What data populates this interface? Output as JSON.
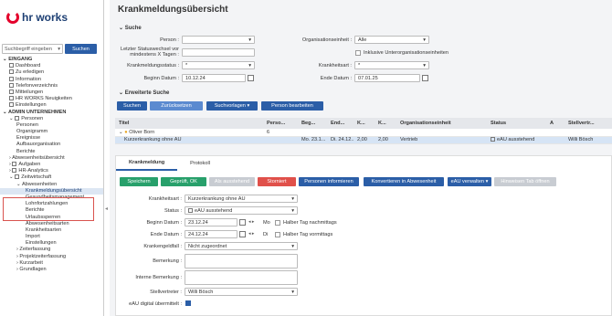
{
  "app": {
    "logo": "hr works"
  },
  "search": {
    "placeholder": "Suchbegriff eingeben",
    "button": "Suchen"
  },
  "nav": {
    "eingang": "EINGANG",
    "eingang_items": [
      "Dashboard",
      "Zu erledigen",
      "Information",
      "Telefonverzeichnis",
      "Mitteilungen",
      "HR WORKS Neuigkeiten",
      "Einstellungen"
    ],
    "admin": "ADMIN UNTERNEHMEN",
    "personen": "Personen",
    "personen_items": [
      "Personen",
      "Organigramm",
      "Ereignisse",
      "Aufbauorganisation",
      "Berichte"
    ],
    "abwesenheitsuebersicht": "Abwesenheitsübersicht",
    "aufgaben": "Aufgaben",
    "hr_analytics": "HR-Analytics",
    "zeitwirtschaft": "Zeitwirtschaft",
    "abwesenheiten": "Abwesenheiten",
    "krankmeldungsuebersicht": "Krankmeldungsübersicht",
    "abw_items": [
      "Gesundheitsmanagement",
      "Lohnfortzahlungen",
      "Berichte",
      "Urlaubssperren",
      "Abwesenheitsarten",
      "Krankheitsarten",
      "Import",
      "Einstellungen"
    ],
    "bottom_items": [
      "Zeiterfassung",
      "Projektzeiterfassung",
      "Kurzarbeit",
      "Grundlagen"
    ]
  },
  "page": {
    "title": "Krankmeldungsübersicht"
  },
  "suche": {
    "heading": "Suche",
    "person_label": "Person :",
    "person_value": "",
    "letzter_label1": "Letzter Statuswechsel vor",
    "letzter_label2": "mindestens X Tagen :",
    "status_label": "Krankmeldungsstatus :",
    "status_value": "*",
    "beginn_label": "Beginn Datum :",
    "beginn_value": "10.12.24",
    "org_label": "Organisationseinheit :",
    "org_value": "Alle",
    "inkl_label": "Inklusive Unterorganisationseinheiten",
    "krankheitsart_label": "Krankheitsart :",
    "krankheitsart_value": "*",
    "ende_label": "Ende Datum :",
    "ende_value": "07.01.25"
  },
  "erweitert": {
    "heading": "Erweiterte Suche"
  },
  "actions": {
    "suchen": "Suchen",
    "zuruecksetzen": "Zurücksetzen",
    "suchvorlagen": "Suchvorlagen",
    "person_bearbeiten": "Person bearbeiten"
  },
  "table": {
    "headers": [
      "Titel",
      "Perso...",
      "Beg...",
      "End...",
      "K...",
      "K...",
      "Organisationseinheit",
      "Status",
      "A",
      "",
      "Stellvertr..."
    ],
    "rows": [
      {
        "titel": "Oliver Born",
        "perso": "6",
        "beg": "",
        "end": "",
        "k1": "",
        "k2": "",
        "org": "",
        "status": "",
        "stell": ""
      },
      {
        "titel": "Kurzerkrankung ohne AU",
        "perso": "",
        "beg": "Mo. 23.1...",
        "end": "Di. 24.12...",
        "k1": "2,00",
        "k2": "2,00",
        "org": "Vertrieb",
        "status": "eAU ausstehend",
        "stell": "Willi Bösch"
      }
    ]
  },
  "tabs": {
    "krankmeldung": "Krankmeldung",
    "protokoll": "Protokoll"
  },
  "detail_buttons": {
    "speichern": "Speichern",
    "geprueft": "Geprüft, OK",
    "nicht": "Als ausstehend",
    "storniert": "Storniert",
    "personen_informieren": "Personen informieren",
    "konvertieren": "Konvertieren in Abwesenheit",
    "eau_verwalten": "eAU verwalten",
    "hinweisen": "Hinweisen Tab öffnen"
  },
  "form": {
    "krankheitsart_label": "Krankheitsart :",
    "krankheitsart_value": "Kurzerkrankung ohne AU",
    "status_label": "Status :",
    "status_value": "eAU ausstehend",
    "beginn_label": "Beginn Datum :",
    "beginn_value": "23.12.24",
    "beginn_day": "Mo",
    "halb_nachm": "Halber Tag nachmittags",
    "ende_label": "Ende Datum :",
    "ende_value": "24.12.24",
    "ende_day": "Di",
    "halb_vorm": "Halber Tag vormittags",
    "krankengeld_label": "Krankengeldfall :",
    "krankengeld_value": "Nicht zugeordnet",
    "bemerkung_label": "Bemerkung :",
    "interne_label": "Interne Bemerkung :",
    "stellvertreter_label": "Stellvertreter :",
    "stellvertreter_value": "Willi Bösch",
    "eau_label": "eAU digital übermittelt :"
  }
}
